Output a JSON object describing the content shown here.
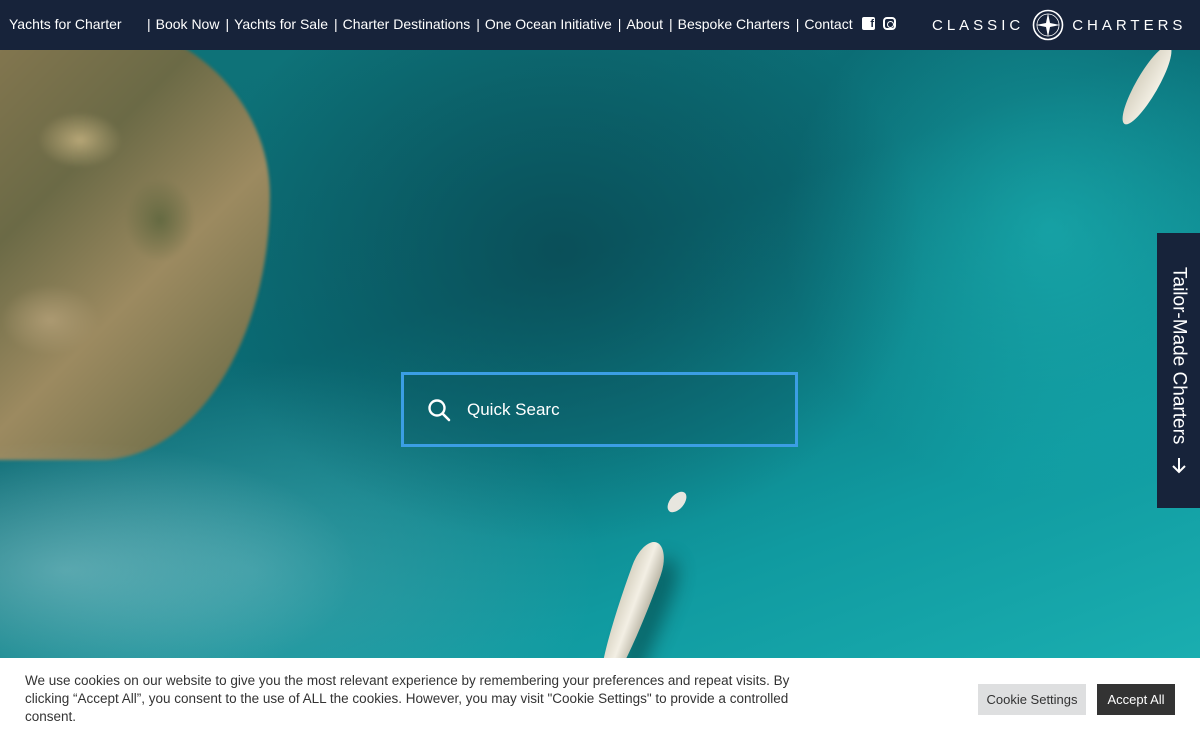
{
  "header": {
    "nav_first": "Yachts for Charter",
    "nav_items": [
      "Book Now",
      "Yachts for Sale",
      "Charter Destinations",
      "One Ocean Initiative",
      "About",
      "Bespoke Charters",
      "Contact"
    ],
    "separator": "|",
    "social": [
      "facebook-icon",
      "instagram-icon"
    ],
    "logo": {
      "left": "CLASSIC",
      "right": "CHARTERS",
      "emblem": "compass-icon"
    }
  },
  "side_tab": {
    "label": "Tailor-Made Charters",
    "icon": "arrow-left-icon"
  },
  "search": {
    "value": "Quick Searc",
    "icon": "search-icon",
    "border_color": "#3b9ee4"
  },
  "cookie": {
    "message": "We use cookies on our website to give you the most relevant experience by remembering your preferences and repeat visits. By clicking “Accept All”, you consent to the use of ALL the cookies. However, you may visit \"Cookie Settings\" to provide a controlled consent.",
    "settings_label": "Cookie Settings",
    "accept_label": "Accept All"
  },
  "colors": {
    "header_bg": "#17233a",
    "accept_bg": "#333333",
    "settings_bg": "#dedfe0"
  }
}
